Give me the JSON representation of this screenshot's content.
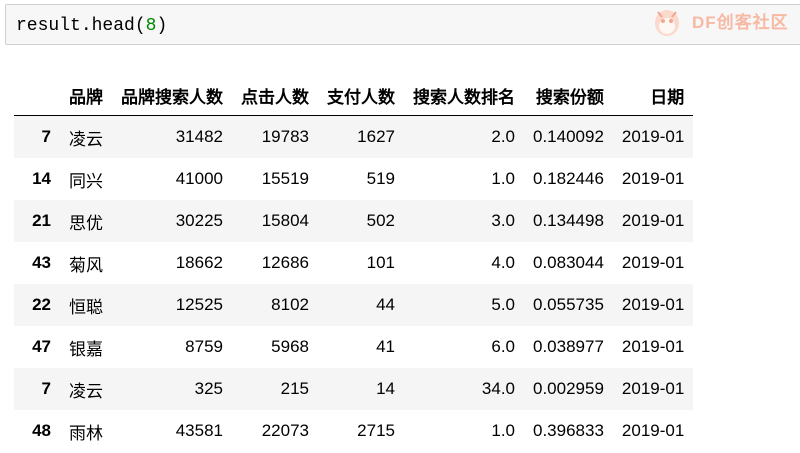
{
  "code_cell": {
    "object": "result",
    "method": "head",
    "argument": "8"
  },
  "watermark": {
    "text": "DF创客社区"
  },
  "table": {
    "columns": [
      "品牌",
      "品牌搜索人数",
      "点击人数",
      "支付人数",
      "搜索人数排名",
      "搜索份额",
      "日期"
    ],
    "rows": [
      {
        "index": "7",
        "cells": [
          "凌云",
          "31482",
          "19783",
          "1627",
          "2.0",
          "0.140092",
          "2019-01"
        ]
      },
      {
        "index": "14",
        "cells": [
          "同兴",
          "41000",
          "15519",
          "519",
          "1.0",
          "0.182446",
          "2019-01"
        ]
      },
      {
        "index": "21",
        "cells": [
          "思优",
          "30225",
          "15804",
          "502",
          "3.0",
          "0.134498",
          "2019-01"
        ]
      },
      {
        "index": "43",
        "cells": [
          "菊风",
          "18662",
          "12686",
          "101",
          "4.0",
          "0.083044",
          "2019-01"
        ]
      },
      {
        "index": "22",
        "cells": [
          "恒聪",
          "12525",
          "8102",
          "44",
          "5.0",
          "0.055735",
          "2019-01"
        ]
      },
      {
        "index": "47",
        "cells": [
          "银嘉",
          "8759",
          "5968",
          "41",
          "6.0",
          "0.038977",
          "2019-01"
        ]
      },
      {
        "index": "7",
        "cells": [
          "凌云",
          "325",
          "215",
          "14",
          "34.0",
          "0.002959",
          "2019-01"
        ]
      },
      {
        "index": "48",
        "cells": [
          "雨林",
          "43581",
          "22073",
          "2715",
          "1.0",
          "0.396833",
          "2019-01"
        ]
      }
    ]
  },
  "colors": {
    "code_bg": "#f7f7f7",
    "code_border": "#cfcfcf",
    "number_literal": "#008800",
    "stripe": "#f5f5f5",
    "watermark": "#f7b9a4"
  }
}
